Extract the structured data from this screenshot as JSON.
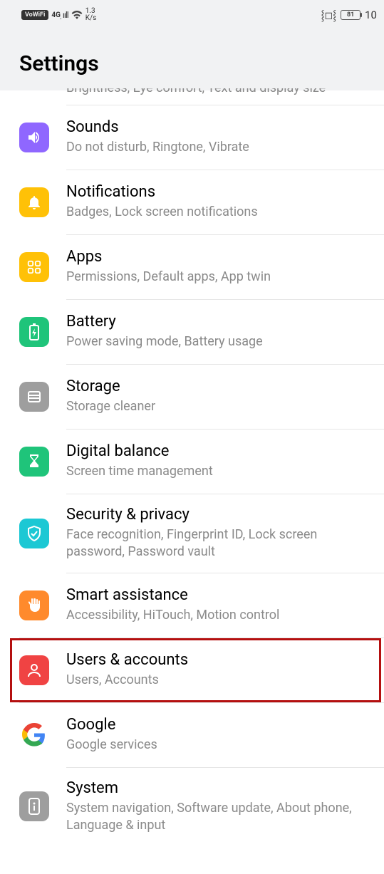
{
  "status": {
    "vowifi": "VoWiFi",
    "net4g": "4G",
    "speed_top": "1.3",
    "speed_bot": "K/s",
    "battery": "81",
    "time": "10"
  },
  "header": {
    "title": "Settings"
  },
  "cutoff_hint": "Brightness, Eye comfort, Text and display size",
  "rows": {
    "sounds": {
      "title": "Sounds",
      "sub": "Do not disturb, Ringtone, Vibrate"
    },
    "notif": {
      "title": "Notifications",
      "sub": "Badges, Lock screen notifications"
    },
    "apps": {
      "title": "Apps",
      "sub": "Permissions, Default apps, App twin"
    },
    "battery": {
      "title": "Battery",
      "sub": "Power saving mode, Battery usage"
    },
    "storage": {
      "title": "Storage",
      "sub": "Storage cleaner"
    },
    "digital": {
      "title": "Digital balance",
      "sub": "Screen time management"
    },
    "security": {
      "title": "Security & privacy",
      "sub": "Face recognition, Fingerprint ID, Lock screen password, Password vault"
    },
    "smart": {
      "title": "Smart assistance",
      "sub": "Accessibility, HiTouch, Motion control"
    },
    "users": {
      "title": "Users & accounts",
      "sub": "Users, Accounts"
    },
    "google": {
      "title": "Google",
      "sub": "Google services"
    },
    "system": {
      "title": "System",
      "sub": "System navigation, Software update, About phone, Language & input"
    }
  }
}
